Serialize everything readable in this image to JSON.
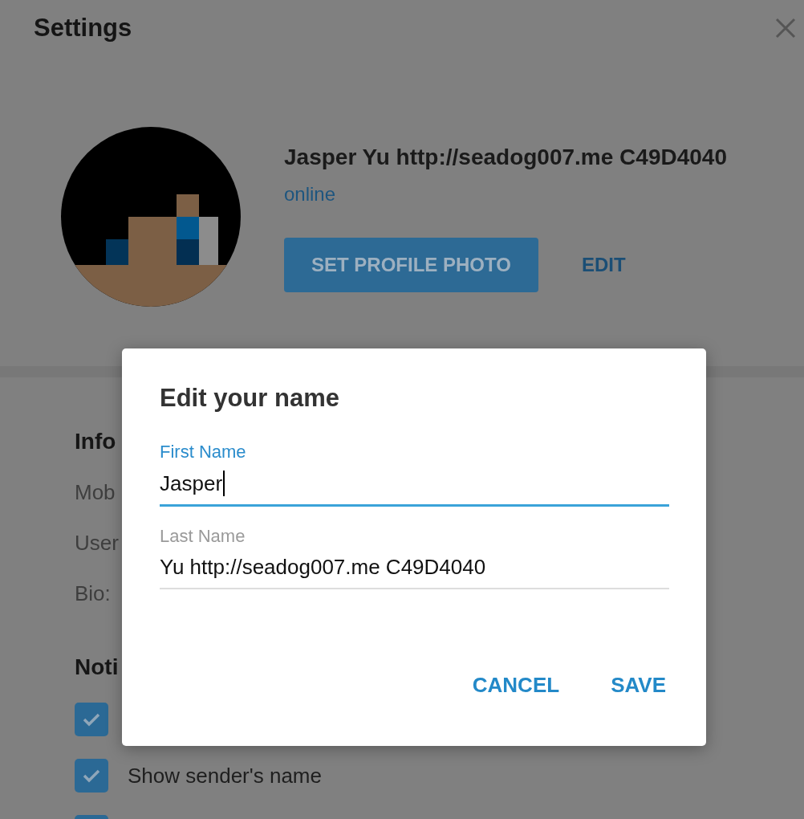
{
  "window": {
    "title": "Settings"
  },
  "profile": {
    "name": "Jasper Yu http://seadog007.me C49D4040",
    "status": "online",
    "buttons": [
      {
        "label": "SET PROFILE PHOTO",
        "kind": "primary"
      },
      {
        "label": "EDIT",
        "kind": "flat"
      }
    ]
  },
  "info": {
    "title": "Info",
    "rows": [
      "Mob",
      "User",
      "Bio:"
    ]
  },
  "notifications": {
    "title": "Noti",
    "checkboxes": [
      {
        "checked": true
      },
      {
        "label": "Show sender's name",
        "checked": true
      },
      {
        "checked": true
      }
    ]
  },
  "dialog": {
    "title": "Edit your name",
    "fields": [
      {
        "label": "First Name",
        "value": "Jasper",
        "focused": true
      },
      {
        "label": "Last Name",
        "value": "Yu http://seadog007.me C49D4040",
        "focused": false
      }
    ],
    "buttons": [
      "CANCEL",
      "SAVE"
    ]
  }
}
